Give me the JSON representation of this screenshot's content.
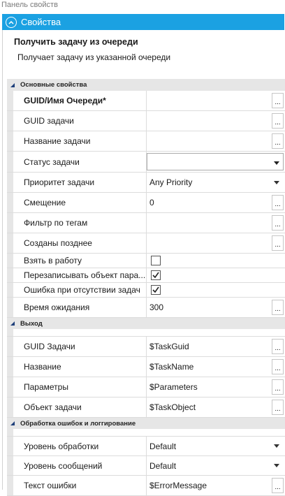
{
  "panel_title": "Панель свойств",
  "section_title": "Свойства",
  "activity": {
    "name": "Получить задачу из очереди",
    "description": "Получает задачу из указанной очереди"
  },
  "groups": {
    "main": {
      "label": "Основные свойства",
      "rows": {
        "queue_guid": {
          "label": "GUID/Имя Очереди*",
          "value": ""
        },
        "task_guid": {
          "label": "GUID задачи",
          "value": ""
        },
        "task_name": {
          "label": "Название задачи",
          "value": ""
        },
        "task_status": {
          "label": "Статус задачи",
          "value": ""
        },
        "task_priority": {
          "label": "Приоритет задачи",
          "value": "Any Priority"
        },
        "offset": {
          "label": "Смещение",
          "value": "0"
        },
        "tag_filter": {
          "label": "Фильтр по тегам",
          "value": ""
        },
        "created_after": {
          "label": "Созданы позднее",
          "value": ""
        },
        "take_to_work": {
          "label": "Взять в работу",
          "checked": false
        },
        "overwrite_object": {
          "label": "Перезаписывать объект пара...",
          "checked": true
        },
        "error_if_empty": {
          "label": "Ошибка при отсутствии задач",
          "checked": true
        },
        "wait_time": {
          "label": "Время ожидания",
          "value": "300"
        }
      }
    },
    "output": {
      "label": "Выход",
      "rows": {
        "task_guid_out": {
          "label": "GUID Задачи",
          "value": "$TaskGuid"
        },
        "name_out": {
          "label": "Название",
          "value": "$TaskName"
        },
        "params_out": {
          "label": "Параметры",
          "value": "$Parameters"
        },
        "task_object_out": {
          "label": "Объект задачи",
          "value": "$TaskObject"
        }
      }
    },
    "errors": {
      "label": "Обработка ошибок и логгирование",
      "rows": {
        "handling_level": {
          "label": "Уровень обработки",
          "value": "Default"
        },
        "message_level": {
          "label": "Уровень сообщений",
          "value": "Default"
        },
        "error_text": {
          "label": "Текст ошибки",
          "value": "$ErrorMessage"
        }
      }
    }
  },
  "ellipsis_label": "...",
  "colors": {
    "header": "#1ba1e2",
    "group_bg": "#e6e6e6"
  }
}
